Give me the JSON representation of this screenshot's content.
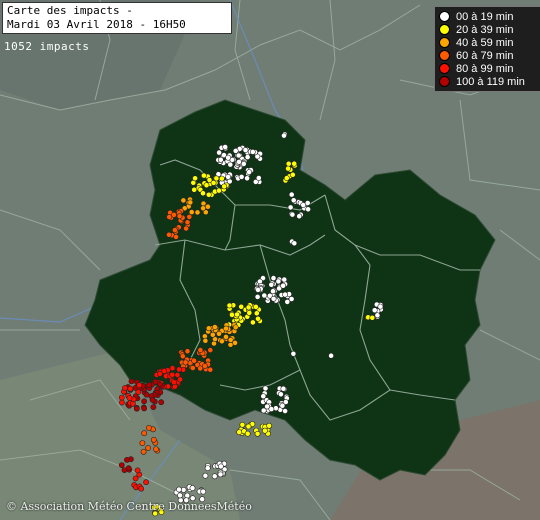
{
  "header": {
    "title_line1": "Carte des impacts -",
    "title_line2": "Mardi 03 Avril 2018 - 16H50",
    "impact_count": "1052 impacts"
  },
  "legend": {
    "items": [
      {
        "label": "00 à 19 min",
        "color": "#ffffff"
      },
      {
        "label": "20 à 39 min",
        "color": "#ffff00"
      },
      {
        "label": "40 à 59 min",
        "color": "#ffa500"
      },
      {
        "label": "60 à 79 min",
        "color": "#ff5a00"
      },
      {
        "label": "80 à 99 min",
        "color": "#ff1000"
      },
      {
        "label": "100 à 119 min",
        "color": "#b00000"
      }
    ]
  },
  "footer": {
    "copyright": "© Association Météo Centre DonneesMétéo"
  },
  "colors": {
    "background": "#6b7a72",
    "region_fill": "#0f3315",
    "border_line": "#8ea594",
    "river_line": "#5d7fb0"
  }
}
